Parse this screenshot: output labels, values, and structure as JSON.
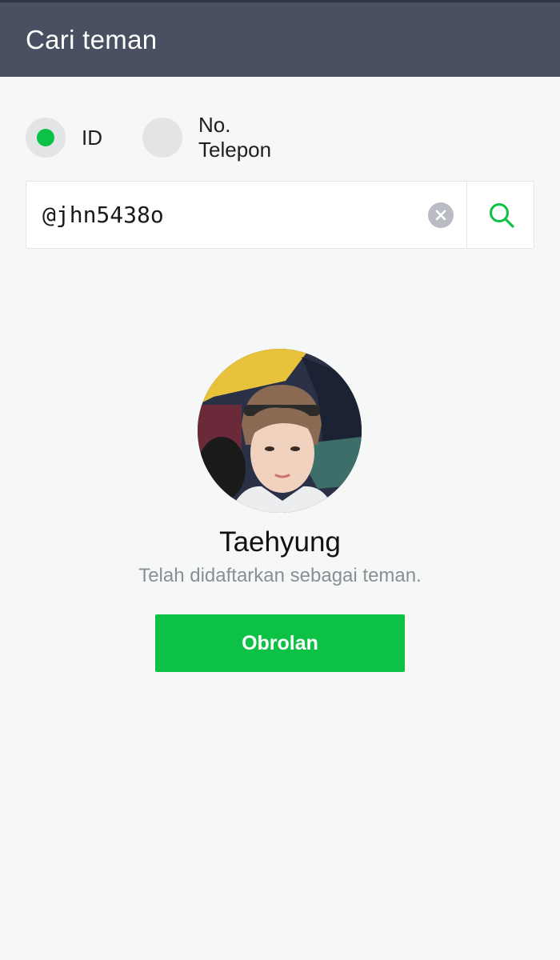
{
  "header": {
    "title": "Cari teman"
  },
  "search_type": {
    "options": [
      {
        "label": "ID",
        "selected": true
      },
      {
        "label": "No. Telepon",
        "selected": false
      }
    ]
  },
  "search": {
    "value": "@jhn5438o",
    "clear_icon": "clear-circle-icon",
    "search_icon": "search-icon"
  },
  "result": {
    "name": "Taehyung",
    "status": "Telah didaftarkan sebagai teman.",
    "chat_button": "Obrolan"
  },
  "colors": {
    "header_bg": "#485061",
    "accent": "#0cc145",
    "page_bg": "#f6f7f7"
  }
}
